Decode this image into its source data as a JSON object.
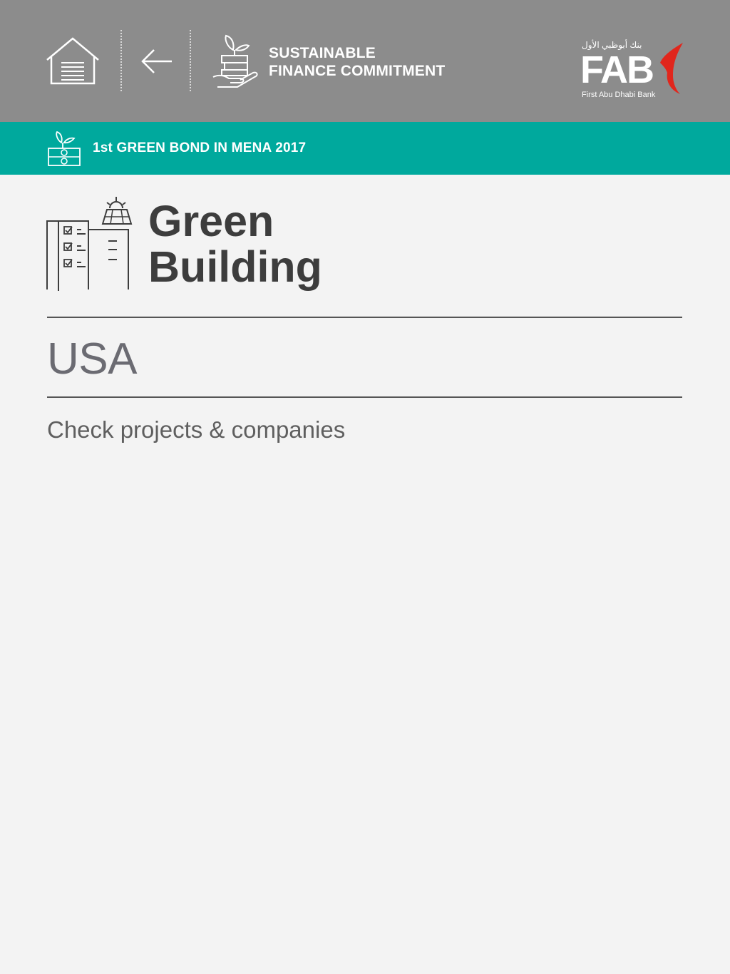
{
  "header": {
    "title_line1": "SUSTAINABLE",
    "title_line2": "FINANCE COMMITMENT",
    "background": "#8c8c8c",
    "icons": [
      "home-icon",
      "back-arrow-icon",
      "hand-plant-money-icon"
    ],
    "logo": {
      "arabic": "بنك أبوظبي الأول",
      "wordmark": "FAB",
      "subtitle": "First Abu Dhabi Bank",
      "accent_color": "#e1261c"
    }
  },
  "banner": {
    "text": "1st GREEN BOND IN MENA 2017",
    "background": "#00a99d",
    "icon": "money-plant-icon"
  },
  "section": {
    "title_line1": "Green",
    "title_line2": "Building",
    "icon": "green-building-icon"
  },
  "country": "USA",
  "link_text": "Check projects & companies"
}
